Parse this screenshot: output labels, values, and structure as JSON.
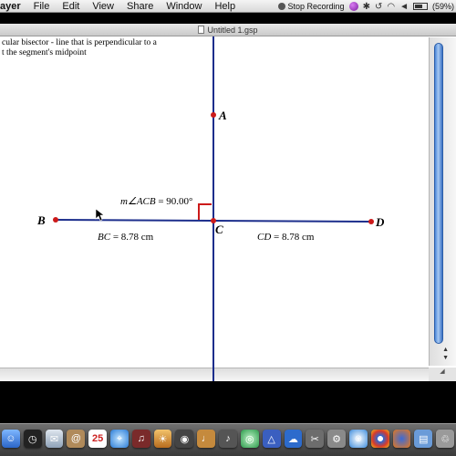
{
  "menubar": {
    "app_name": "ayer",
    "items": [
      "File",
      "Edit",
      "View",
      "Share",
      "Window",
      "Help"
    ],
    "status": {
      "recording": "Stop Recording",
      "battery": "(59%)"
    }
  },
  "window": {
    "title": "Untitled 1.gsp"
  },
  "note": {
    "line1": "cular bisector - line that is perpendicular to a",
    "line2": "t the segment's midpoint"
  },
  "sketch": {
    "points": {
      "A": "A",
      "B": "B",
      "C": "C",
      "D": "D"
    },
    "angle_measure": {
      "prefix": "m",
      "text": "∠ACB",
      "value": " = 90.00°"
    },
    "bc_measure": {
      "name": "BC",
      "value": " = 8.78 cm"
    },
    "cd_measure": {
      "name": "CD",
      "value": " = 8.78 cm"
    },
    "colors": {
      "line": "#1c2e8c",
      "point": "#cc1a1a",
      "angle_marker": "#cc1a1a"
    }
  },
  "dock": {
    "calendar_day": "25",
    "icons": [
      "finder-icon",
      "clock-icon",
      "mail-icon",
      "address-book-icon",
      "calendar-icon",
      "safari-icon",
      "itunes-icon",
      "photo-icon",
      "camera-icon",
      "guitar-icon",
      "music-icon",
      "web-icon",
      "sketch-icon",
      "chat-icon",
      "scissors-icon",
      "settings-icon",
      "ichat-icon",
      "chrome-icon",
      "firefox-icon",
      "folder-icon",
      "trash-icon"
    ]
  }
}
